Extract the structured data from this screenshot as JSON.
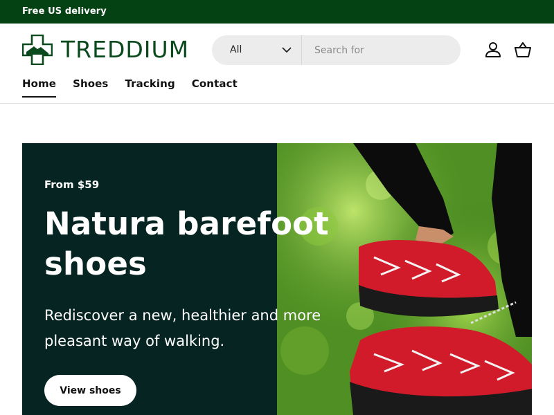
{
  "announcement": {
    "text": "Free US delivery"
  },
  "brand": {
    "name": "TREDDIUM"
  },
  "search": {
    "category_selected": "All",
    "placeholder": "Search for",
    "value": ""
  },
  "nav": {
    "items": [
      {
        "label": "Home",
        "active": true
      },
      {
        "label": "Shoes"
      },
      {
        "label": "Tracking"
      },
      {
        "label": "Contact"
      }
    ]
  },
  "hero": {
    "eyebrow": "From $59",
    "title": "Natura barefoot shoes",
    "subtitle": "Rediscover a new, healthier and more pleasant way of walking.",
    "cta_label": "View shoes"
  },
  "colors": {
    "topbar": "#044213",
    "brand_green": "#0b4a1c",
    "hero_bg": "#062421"
  },
  "icons": [
    "logo-cross-shoe",
    "chevron-down",
    "account",
    "basket"
  ]
}
